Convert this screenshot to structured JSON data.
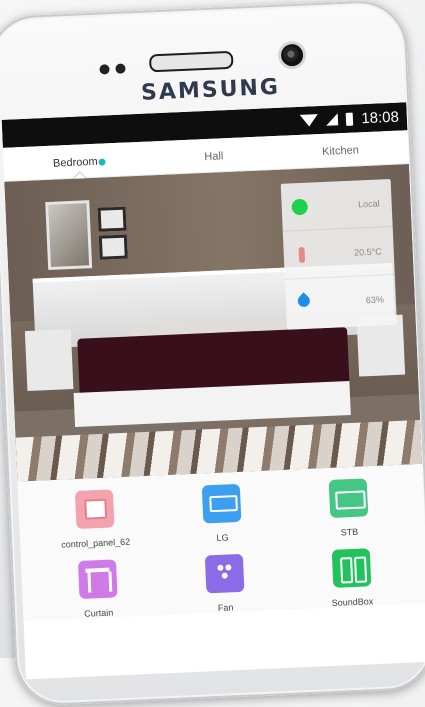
{
  "phone": {
    "brand": "SAMSUNG"
  },
  "status_bar": {
    "time": "18:08"
  },
  "tabs": [
    {
      "label": "Bedroom",
      "active": true
    },
    {
      "label": "Hall",
      "active": false
    },
    {
      "label": "Kitchen",
      "active": false
    }
  ],
  "sensors": [
    {
      "name": "status",
      "value": "Local",
      "icon": "status-dot-icon"
    },
    {
      "name": "temperature",
      "value": "20.5°C",
      "icon": "thermometer-icon"
    },
    {
      "name": "humidity",
      "value": "63%",
      "icon": "water-drop-icon"
    }
  ],
  "devices": [
    {
      "label": "control_panel_62",
      "icon": "control-panel-icon",
      "color": "#f2a3ad"
    },
    {
      "label": "LG",
      "icon": "air-conditioner-icon",
      "color": "#3c9ff0"
    },
    {
      "label": "STB",
      "icon": "set-top-box-icon",
      "color": "#44c785"
    },
    {
      "label": "Curtain",
      "icon": "curtain-icon",
      "color": "#d07ae8"
    },
    {
      "label": "Fan",
      "icon": "fan-icon",
      "color": "#8b6be6"
    },
    {
      "label": "SoundBox",
      "icon": "speaker-icon",
      "color": "#22c25d"
    }
  ],
  "colors": {
    "accent": "#1fb7c7"
  }
}
